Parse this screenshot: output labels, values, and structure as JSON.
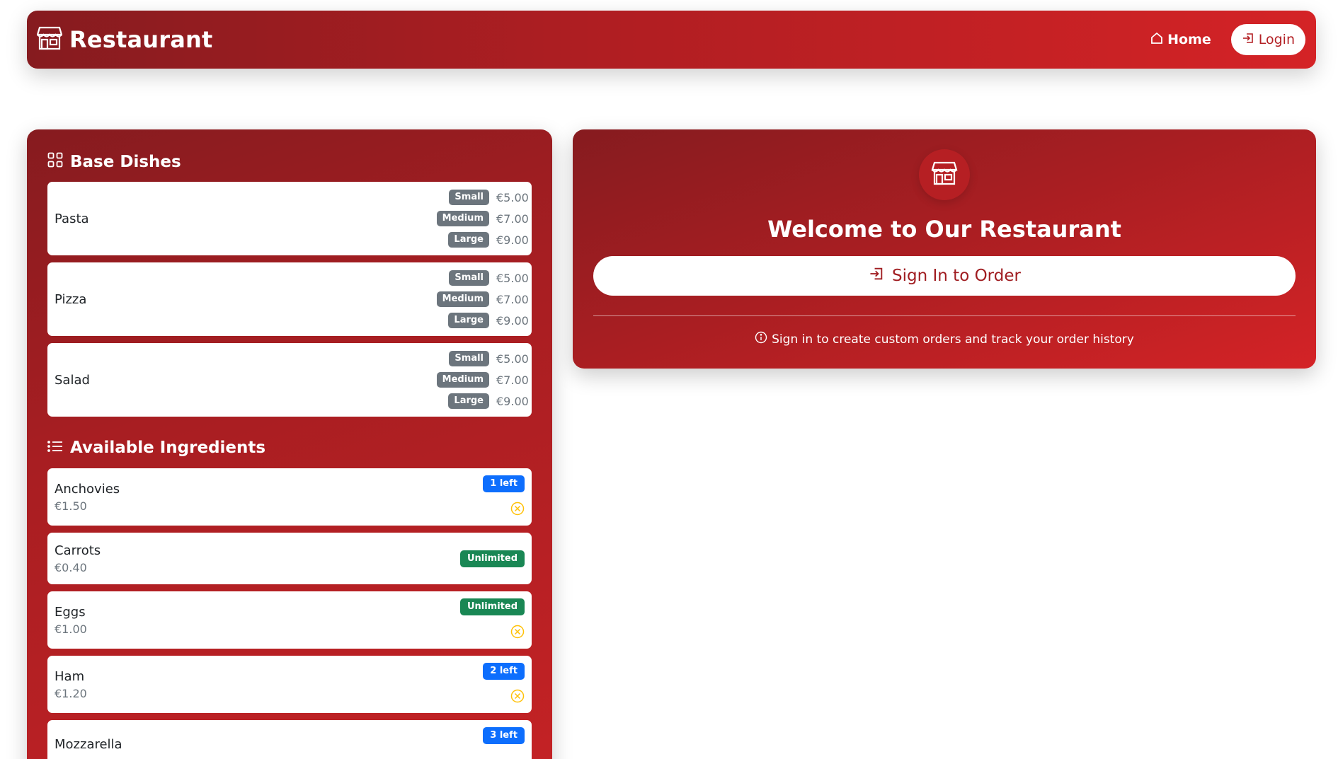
{
  "nav": {
    "brand": "Restaurant",
    "brand_icon": "shop-icon",
    "home": "Home",
    "login": "Login"
  },
  "base_dishes": {
    "title": "Base Dishes",
    "items": [
      {
        "name": "Pasta",
        "sizes": [
          {
            "label": "Small",
            "price": "€5.00"
          },
          {
            "label": "Medium",
            "price": "€7.00"
          },
          {
            "label": "Large",
            "price": "€9.00"
          }
        ]
      },
      {
        "name": "Pizza",
        "sizes": [
          {
            "label": "Small",
            "price": "€5.00"
          },
          {
            "label": "Medium",
            "price": "€7.00"
          },
          {
            "label": "Large",
            "price": "€9.00"
          }
        ]
      },
      {
        "name": "Salad",
        "sizes": [
          {
            "label": "Small",
            "price": "€5.00"
          },
          {
            "label": "Medium",
            "price": "€7.00"
          },
          {
            "label": "Large",
            "price": "€9.00"
          }
        ]
      }
    ]
  },
  "ingredients": {
    "title": "Available Ingredients",
    "items": [
      {
        "name": "Anchovies",
        "price": "€1.50",
        "stock": "1 left",
        "stock_color": "#0d6efd",
        "warning": true
      },
      {
        "name": "Carrots",
        "price": "€0.40",
        "stock": "Unlimited",
        "stock_color": "#198754",
        "warning": false
      },
      {
        "name": "Eggs",
        "price": "€1.00",
        "stock": "Unlimited",
        "stock_color": "#198754",
        "warning": true
      },
      {
        "name": "Ham",
        "price": "€1.20",
        "stock": "2 left",
        "stock_color": "#0d6efd",
        "warning": true
      },
      {
        "name": "Mozzarella",
        "price": "",
        "stock": "3 left",
        "stock_color": "#0d6efd",
        "warning": false
      }
    ]
  },
  "welcome": {
    "title": "Welcome to Our Restaurant",
    "button": "Sign In to Order",
    "hint": "Sign in to create custom orders and track your order history"
  },
  "colors": {
    "brand_dark": "#861b1f",
    "brand_light": "#d42326",
    "warning_icon": "#ffc107"
  }
}
